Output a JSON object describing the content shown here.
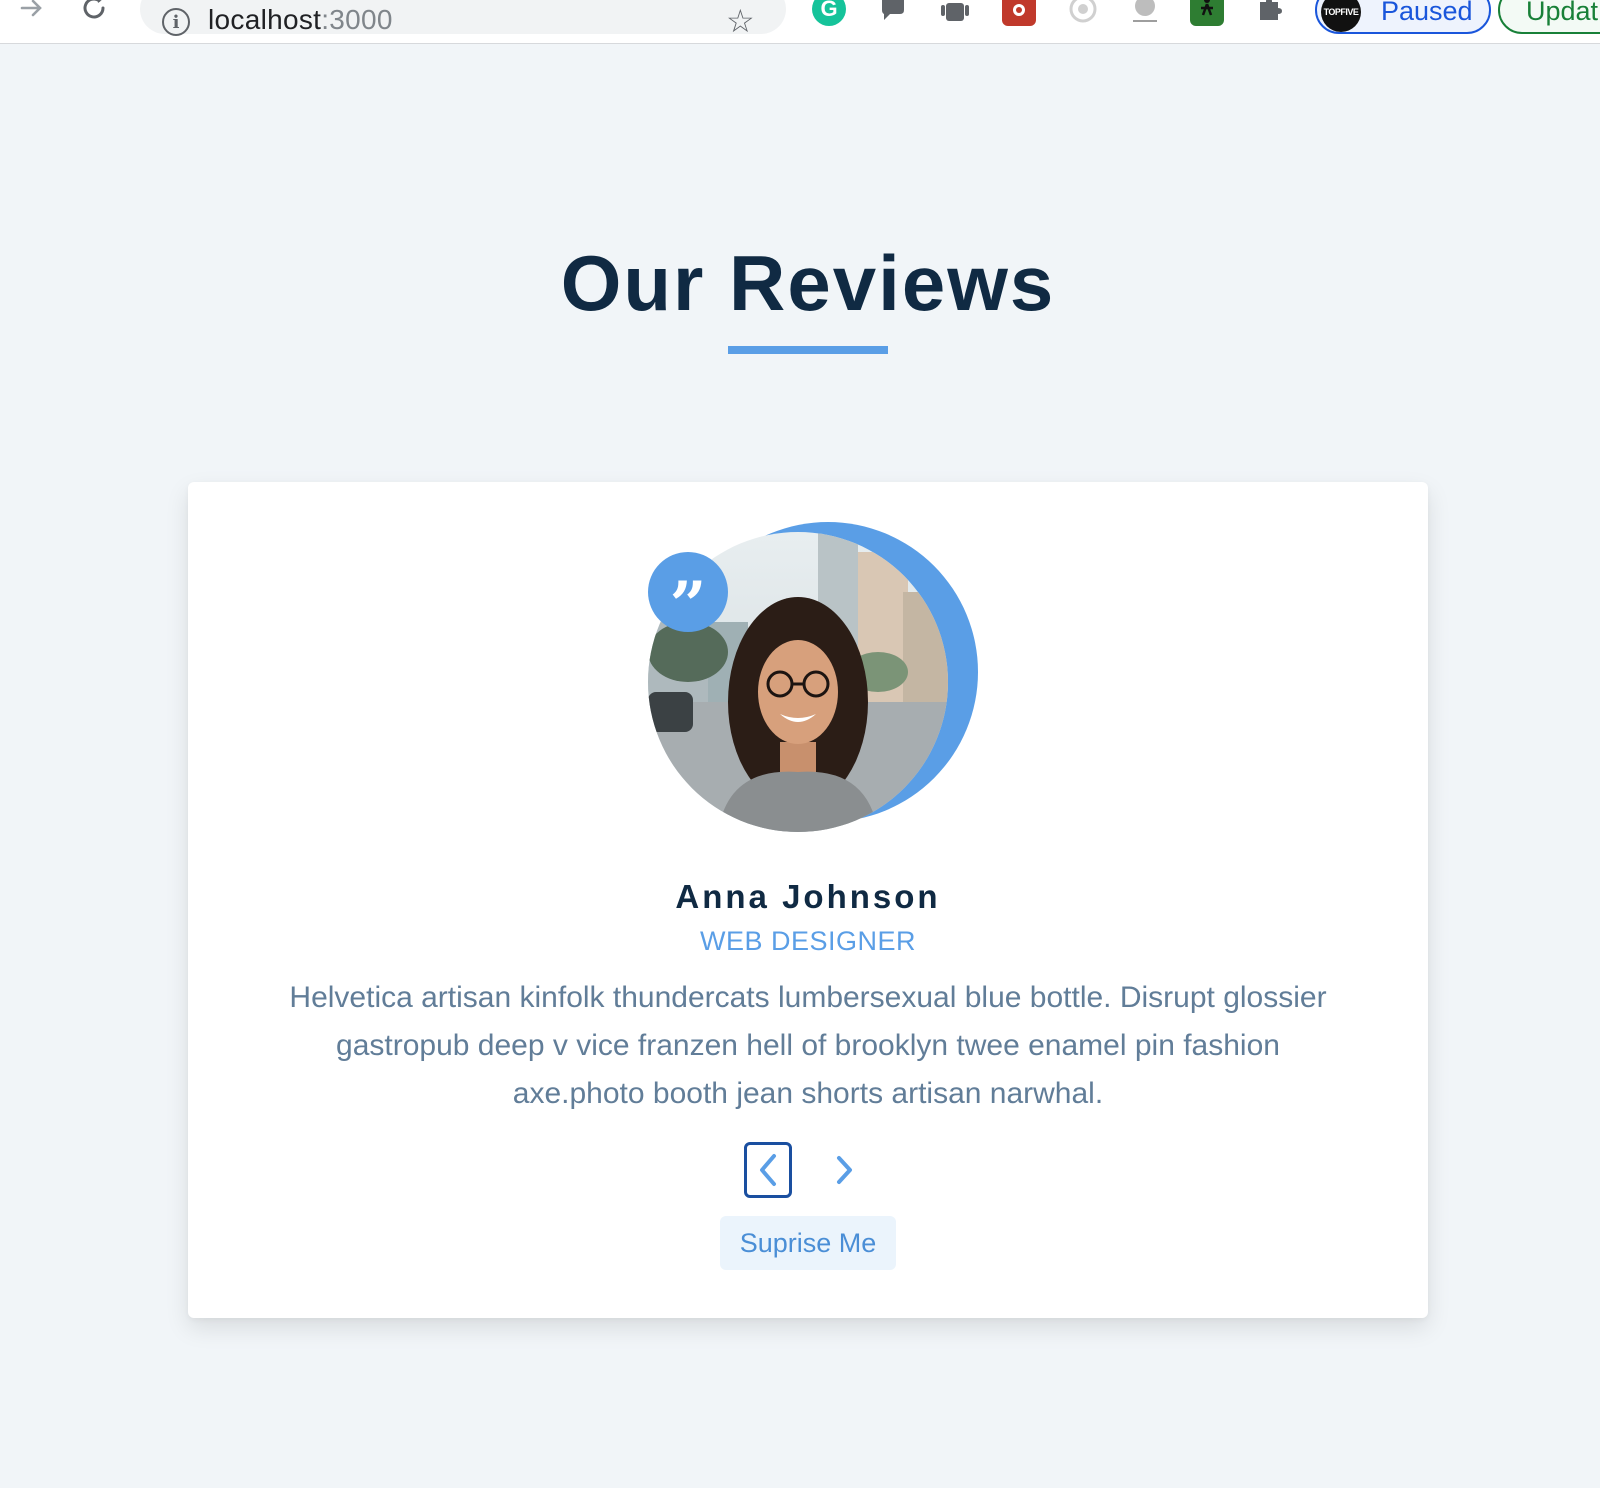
{
  "browser": {
    "url_host": "localhost",
    "url_port": ":3000",
    "profile_status": "Paused",
    "profile_avatar_text": "TOPFIVE",
    "update_label": "Updat",
    "extensions": [
      {
        "icon": "grammarly-icon",
        "glyph": "G",
        "color": "#15c39a"
      },
      {
        "icon": "chat-bubble-icon",
        "glyph": "",
        "color": "#5f6368"
      },
      {
        "icon": "android-icon",
        "glyph": "",
        "color": "#5f6368"
      },
      {
        "icon": "bug-icon",
        "glyph": "",
        "color": "#c0392b"
      },
      {
        "icon": "target-icon",
        "glyph": "",
        "color": "#bdbdbd"
      },
      {
        "icon": "music-icon",
        "glyph": "",
        "color": "#9e9e9e"
      },
      {
        "icon": "figure-icon",
        "glyph": "",
        "color": "#2e7d32"
      },
      {
        "icon": "puzzle-icon",
        "glyph": "",
        "color": "#5f6368"
      }
    ]
  },
  "section": {
    "title": "Our Reviews"
  },
  "review": {
    "name": "Anna Johnson",
    "job": "WEB DESIGNER",
    "text": "Helvetica artisan kinfolk thundercats lumbersexual blue bottle. Disrupt glossier gastropub deep v vice franzen hell of brooklyn twee enamel pin fashion axe.photo booth jean shorts artisan narwhal.",
    "quote_glyph": "”"
  },
  "controls": {
    "prev_glyph": "‹",
    "next_glyph": "›",
    "random_label": "Suprise Me"
  },
  "colors": {
    "primary": "#5a9ee6",
    "title": "#102a43",
    "body_text": "#617d98",
    "background": "#f1f5f8"
  }
}
